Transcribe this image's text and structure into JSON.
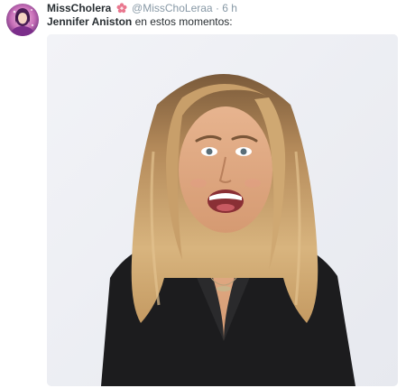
{
  "tweet": {
    "author": {
      "display_name": "MissCholera",
      "badge_icon": "cherry-blossom-icon",
      "handle": "@MissChoLeraa",
      "separator": "·",
      "time": "6 h"
    },
    "text": {
      "mention": "Jennifer Aniston",
      "body": "en estos momentos:"
    },
    "media": {
      "description_icon": "photo-woman-surprised"
    }
  },
  "colors": {
    "name": "#292f33",
    "meta": "#8899a6",
    "badge": "#e9778e",
    "photo_bg": "#eef0f5"
  }
}
